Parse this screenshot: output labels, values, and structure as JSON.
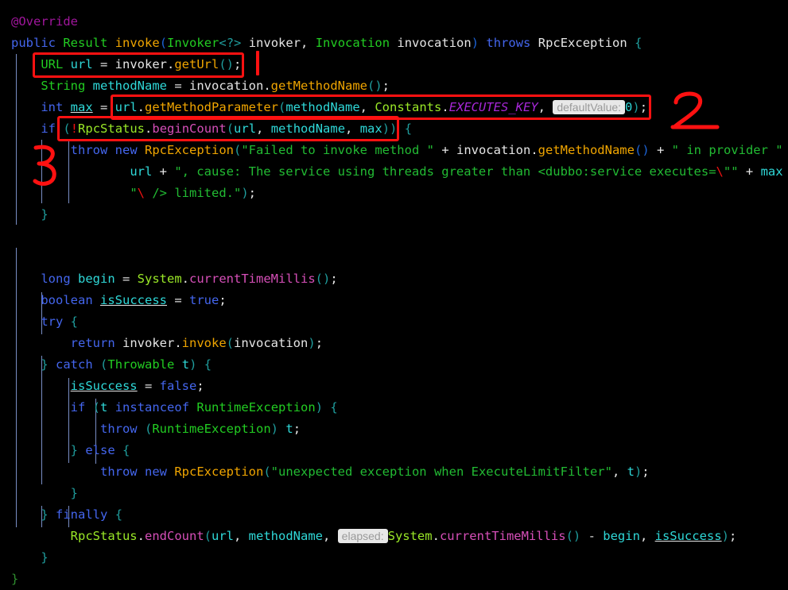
{
  "editor": {
    "language": "java",
    "theme": "dark-black",
    "background_color": "#000000",
    "filename_context": "ExecuteLimitFilter.invoke"
  },
  "code_lines": [
    {
      "n": 1,
      "text": "@Override"
    },
    {
      "n": 2,
      "text": "public Result invoke(Invoker<?> invoker, Invocation invocation) throws RpcException {"
    },
    {
      "n": 3,
      "text": "    URL url = invoker.getUrl();"
    },
    {
      "n": 4,
      "text": "    String methodName = invocation.getMethodName();"
    },
    {
      "n": 5,
      "text": "    int max = url.getMethodParameter(methodName, Constants.EXECUTES_KEY, defaultValue: 0);"
    },
    {
      "n": 6,
      "text": "    if (!RpcStatus.beginCount(url, methodName, max)) {"
    },
    {
      "n": 7,
      "text": "        throw new RpcException(\"Failed to invoke method \" + invocation.getMethodName() + \" in provider \" +"
    },
    {
      "n": 8,
      "text": "                url + \", cause: The service using threads greater than <dubbo:service executes=\\\"\" + max +"
    },
    {
      "n": 9,
      "text": "                \"\\\" /> limited.\");"
    },
    {
      "n": 10,
      "text": "    }"
    },
    {
      "n": 11,
      "text": ""
    },
    {
      "n": 12,
      "text": ""
    },
    {
      "n": 13,
      "text": "    long begin = System.currentTimeMillis();"
    },
    {
      "n": 14,
      "text": "    boolean isSuccess = true;"
    },
    {
      "n": 15,
      "text": "    try {"
    },
    {
      "n": 16,
      "text": "        return invoker.invoke(invocation);"
    },
    {
      "n": 17,
      "text": "    } catch (Throwable t) {"
    },
    {
      "n": 18,
      "text": "        isSuccess = false;"
    },
    {
      "n": 19,
      "text": "        if (t instanceof RuntimeException) {"
    },
    {
      "n": 20,
      "text": "            throw (RuntimeException) t;"
    },
    {
      "n": 21,
      "text": "        } else {"
    },
    {
      "n": 22,
      "text": "            throw new RpcException(\"unexpected exception when ExecuteLimitFilter\", t);"
    },
    {
      "n": 23,
      "text": "        }"
    },
    {
      "n": 24,
      "text": "    } finally {"
    },
    {
      "n": 25,
      "text": "        RpcStatus.endCount(url, methodName, elapsed: System.currentTimeMillis() - begin, isSuccess);"
    },
    {
      "n": 26,
      "text": "    }"
    },
    {
      "n": 27,
      "text": "}"
    }
  ],
  "tokens": {
    "annotation_override": "@Override",
    "kw_public": "public",
    "type_result": "Result",
    "meth_invoke": "invoke",
    "type_invoker": "Invoker",
    "generic_wildcard": "<?>",
    "var_invoker": "invoker",
    "type_invocation": "Invocation",
    "var_invocation": "invocation",
    "kw_throws": "throws",
    "type_rpcexception": "RpcException",
    "type_url": "URL",
    "var_url": "url",
    "meth_geturl": "getUrl",
    "type_string": "String",
    "var_methodname": "methodName",
    "meth_getmethodname": "getMethodName",
    "kw_int": "int",
    "var_max": "max",
    "meth_getmethodparameter": "getMethodParameter",
    "cls_constants": "Constants",
    "const_executes_key": "EXECUTES_KEY",
    "hint_defaultvalue": "defaultValue:",
    "literal_zero": "0",
    "kw_if": "if",
    "cls_rpcstatus": "RpcStatus",
    "meth_begincount": "beginCount",
    "kw_throw": "throw",
    "kw_new": "new",
    "str_failed": "\"Failed to invoke method \"",
    "str_in_provider": "\" in provider \"",
    "str_cause": "\", cause: The service using threads greater than <dubbo:service executes=",
    "escape_quote": "\\",
    "str_limited": " /> limited.\"",
    "kw_long": "long",
    "var_begin": "begin",
    "cls_system": "System",
    "meth_currenttimemillis": "currentTimeMillis",
    "kw_boolean": "boolean",
    "var_issuccess": "isSuccess",
    "kw_true": "true",
    "kw_false": "false",
    "kw_try": "try",
    "kw_return": "return",
    "kw_catch": "catch",
    "type_throwable": "Throwable",
    "var_t": "t",
    "kw_instanceof": "instanceof",
    "type_runtimeexception": "RuntimeException",
    "kw_else": "else",
    "str_unexpected": "\"unexpected exception when ExecuteLimitFilter\"",
    "kw_finally": "finally",
    "meth_endcount": "endCount",
    "hint_elapsed": "elapsed:"
  },
  "annotations": [
    {
      "id": "1",
      "label": "1",
      "shape": "vertical-stroke",
      "target_line": 3,
      "description": "red stroke marking step 1 next to URL url = invoker.getUrl();"
    },
    {
      "id": "2",
      "label": "2",
      "shape": "handwritten-digit",
      "target_line": 5,
      "description": "red handwritten 2 marking getMethodParameter call"
    },
    {
      "id": "3",
      "label": "3",
      "shape": "handwritten-digit",
      "target_line": 7,
      "description": "red handwritten 3 marking the throw RpcException block"
    }
  ],
  "highlight_boxes": [
    {
      "id": "box-1",
      "target_line": 3,
      "description": "red rectangle around URL url = invoker.getUrl();"
    },
    {
      "id": "box-2",
      "target_line": 5,
      "description": "red rectangle around url.getMethodParameter(...) call"
    },
    {
      "id": "box-3",
      "target_line": 6,
      "description": "red rectangle around !RpcStatus.beginCount(url, methodName, max)"
    }
  ],
  "colors": {
    "background": "#000000",
    "keyword": "#4466ee",
    "type": "#22cc22",
    "class_ref": "#9ae827",
    "method": "#f0a500",
    "method_static": "#d64fb8",
    "variable": "#2fd8d8",
    "string": "#22bb33",
    "annotation": "#a0169c",
    "constant_italic": "#a627d6",
    "escape": "#ee1111",
    "mark_red": "#ff1111",
    "indent_guide": "#8ea7e8",
    "inlay_hint_bg": "#e8e8e8",
    "inlay_hint_fg": "#9a9a9a"
  }
}
